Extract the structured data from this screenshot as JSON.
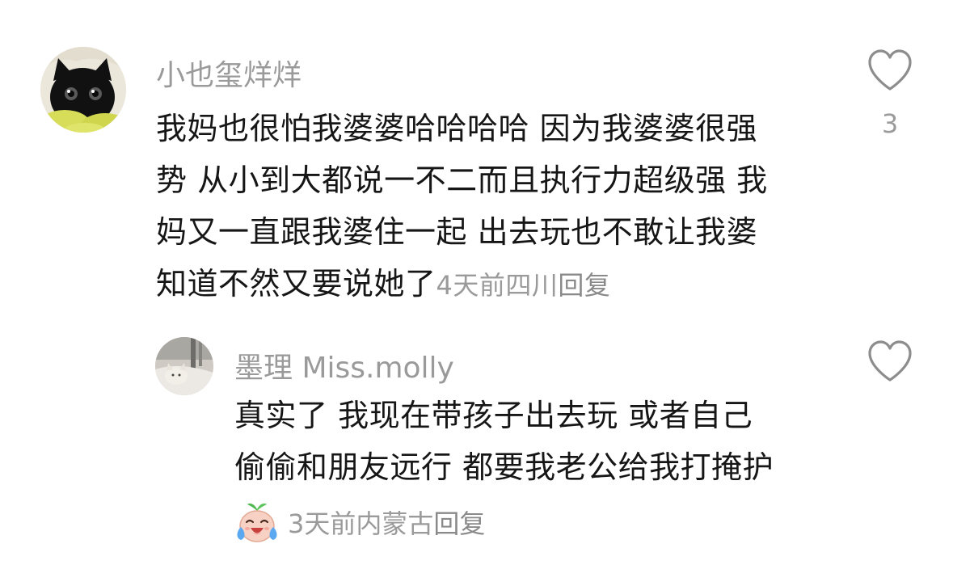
{
  "comments": [
    {
      "username": "小也玺烊烊",
      "lines": [
        "我妈也很怕我婆婆哈哈哈哈 因为我婆婆很强",
        "势 从小到大都说一不二而且执行力超级强 我",
        "妈又一直跟我婆住一起 出去玩也不敢让我婆",
        "知道不然又要说她了"
      ],
      "time": "4天前",
      "location": "四川",
      "reply_label": "回复",
      "like_count": "3",
      "avatar_icon": "black-cat-avatar"
    },
    {
      "username": "墨理 Miss.molly",
      "lines": [
        "真实了 我现在带孩子出去玩 或者自己",
        "偷偷和朋友远行 都要我老公给我打掩护"
      ],
      "time": "3天前",
      "location": "内蒙古",
      "reply_label": "回复",
      "like_count": "",
      "avatar_icon": "cat-on-bed-avatar",
      "emoji_icon": "crying-laughing-emoji"
    }
  ],
  "colors": {
    "meta_gray": "#9a9a9a",
    "text": "#161616",
    "background": "#ffffff"
  }
}
